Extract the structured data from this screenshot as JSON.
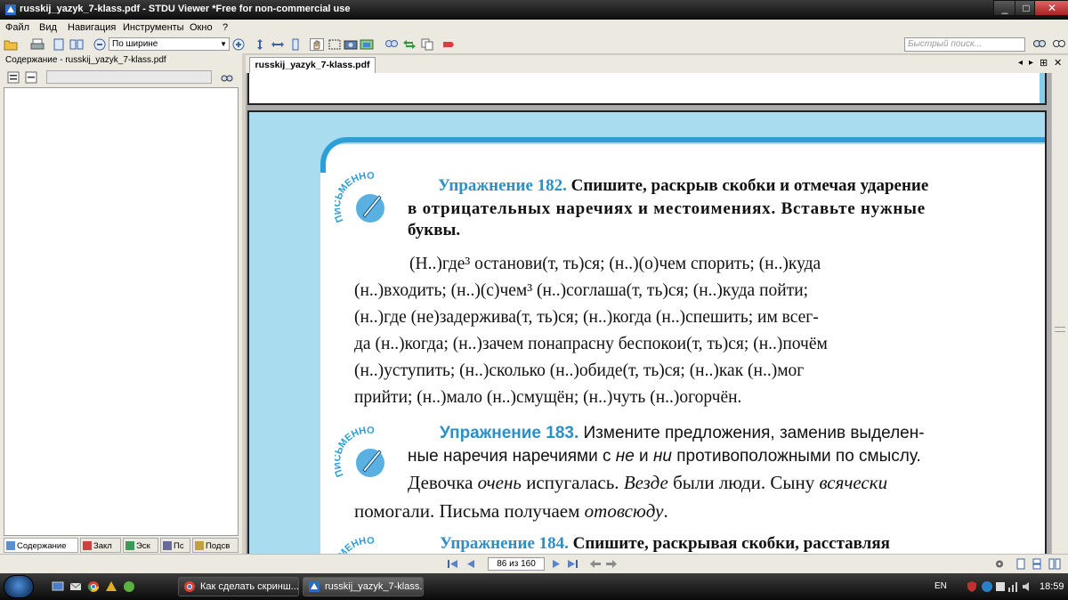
{
  "window": {
    "title": "russkij_yazyk_7-klass.pdf - STDU Viewer *Free for non-commercial use"
  },
  "menu": [
    "Файл",
    "Вид",
    "Навигация",
    "Инструменты",
    "Окно",
    "?"
  ],
  "toolbar": {
    "zoom_value": "По ширине",
    "search_placeholder": "Быстрый поиск..."
  },
  "left_panel": {
    "header": "Содержание - russkij_yazyk_7-klass.pdf",
    "tabs": [
      "Содержание",
      "Закл",
      "Эск",
      "Пс",
      "Подсв"
    ]
  },
  "document": {
    "tab_label": "russkij_yazyk_7-klass.pdf",
    "badge_text": "ПИСЬМЕННО",
    "ex182": {
      "num": "Упражнение 182.",
      "head": [
        " Спишите, раскрыв скобки и отмечая ударение",
        "в отрицательных наречиях и местоимениях. Вставьте нужные",
        "буквы."
      ],
      "lines": [
        "(Н..)где³ останови(т, ть)ся; (н..)(о)чем спорить; (н..)куда",
        "(н..)входить; (н..)(с)чем³ (н..)соглаша(т, ть)ся; (н..)куда пойти;",
        "(н..)где (не)задержива(т, ть)ся; (н..)когда (н..)спешить; им всег-",
        "да (н..)когда; (н..)зачем понапрасну беспокои(т, ть)ся; (н..)почём",
        "(н..)уступить; (н..)сколько (н..)обиде(т, ть)ся; (н..)как (н..)мог",
        "прийти; (н..)мало (н..)смущён; (н..)чуть (н..)огорчён."
      ]
    },
    "ex183": {
      "num": "Упражнение 183.",
      "head1": " Измените предложения, заменив выделен-",
      "head2_a": "ные наречия наречиями с ",
      "head2_ne": "не",
      "head2_b": " и ",
      "head2_ni": "ни",
      "head2_c": " противоположными по смыслу.",
      "line1_a": "Девочка ",
      "line1_b": "очень",
      "line1_c": " испугалась. ",
      "line1_d": "Везде",
      "line1_e": " были люди. Сыну ",
      "line1_f": "всячески",
      "line2_a": "помогали. Письма получаем ",
      "line2_b": "отовсюду",
      "line2_c": "."
    },
    "ex184": {
      "num": "Упражнение 184.",
      "head": " Спишите, раскрывая скобки, расставляя"
    }
  },
  "navigation": {
    "page_indicator": "86 из 160"
  },
  "taskbar": {
    "tasks": [
      "Как сделать скринш...",
      "russkij_yazyk_7-klass...."
    ],
    "language": "EN",
    "clock": "18:59"
  },
  "colors": {
    "accent_blue": "#2c9fd6",
    "page_bg_blue": "#a9dcef",
    "exercise_number": "#2c8fc8"
  }
}
